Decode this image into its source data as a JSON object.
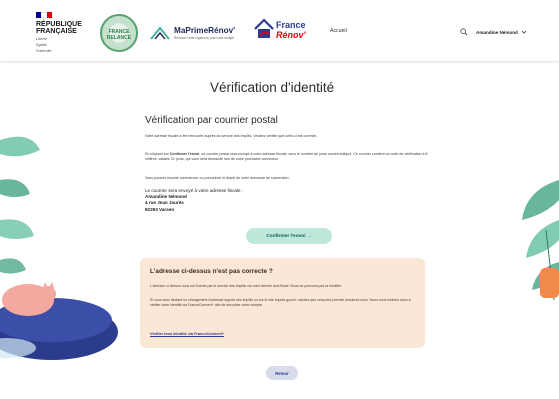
{
  "header": {
    "republique_line1": "RÉPUBLIQUE",
    "republique_line2": "FRANÇAISE",
    "motto_line1": "Liberté",
    "motto_line2": "Égalité",
    "motto_line3": "Fraternité",
    "seal_text": "FRANCE RELANCE",
    "maprimerenov_title": "MaPrimeRénov'",
    "maprimerenov_subtitle": "Rénovez votre logement, pas votre budget",
    "france_renov_line1": "France",
    "france_renov_line2": "Rénov'",
    "nav_accueil": "Accueil",
    "user_name": "Amandine Némond"
  },
  "main": {
    "page_title": "Vérification d'identité",
    "section_title": "Vérification par courrier postal",
    "paragraph1": "Votre adresse fiscale a été retrouvée auprès du service des impôts. Veuillez vérifier que celle-ci est correcte.",
    "paragraph2_prefix": "En cliquant sur",
    "paragraph2_strong": "Confirmer l'envoi",
    "paragraph2_suffix": ", un courrier postal sera envoyé à votre adresse fiscale, sous le nombre de jours ouvrés indiqué. Ce courrier contient un code de vérification à 6 chiffres, valable 21 jours, qui vous sera demandé lors de votre prochaine connexion.",
    "paragraph3": "Vous pourrez ensuite commencer ou poursuivre le dépôt de votre demande de subvention.",
    "address_intro": "Le courrier sera envoyé à votre adresse fiscale :",
    "address_name": "Amandine Némond",
    "address_street": "4 rue Jean Jaurès",
    "address_city": "82293 Varsen",
    "confirm_button": "Confirmer l'envoi →",
    "notice": {
      "title": "L'adresse ci-dessus n'est pas correcte ?",
      "paragraph1": "L'adresse ci-dessus vous est fournie par le service des impôts via votre dernier avis fiscal. Nous ne pouvons pas la modifier.",
      "paragraph2": "Si vous avez déclaré un changement d'adresse auprès des impôts ou sur le site impots.gouv.fr, sachez que cela peut prendre plusieurs mois. Nous vous invitons alors à vérifier votre identité via FranceConnect+ afin de sécuriser votre compte.",
      "link": "Vérifier mon identité via FranceConnect+"
    },
    "back_button": "Retour"
  },
  "colors": {
    "confirm_bg": "#bfe8dd",
    "notice_bg": "#fbe7d6",
    "brand_blue": "#2c3c8c",
    "brand_red": "#e1000f"
  }
}
